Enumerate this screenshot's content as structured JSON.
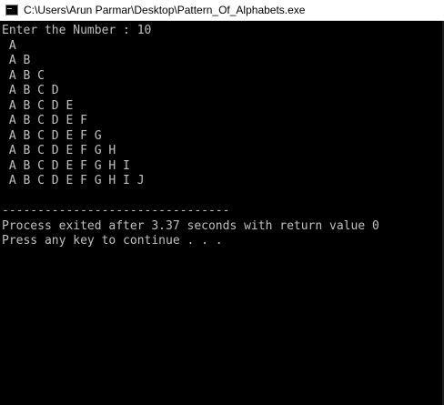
{
  "window": {
    "title": "C:\\Users\\Arun Parmar\\Desktop\\Pattern_Of_Alphabets.exe"
  },
  "console": {
    "lines": [
      "Enter the Number : 10",
      " A",
      " A B",
      " A B C",
      " A B C D",
      " A B C D E",
      " A B C D E F",
      " A B C D E F G",
      " A B C D E F G H",
      " A B C D E F G H I",
      " A B C D E F G H I J",
      "",
      "--------------------------------",
      "Process exited after 3.37 seconds with return value 0",
      "Press any key to continue . . ."
    ]
  }
}
